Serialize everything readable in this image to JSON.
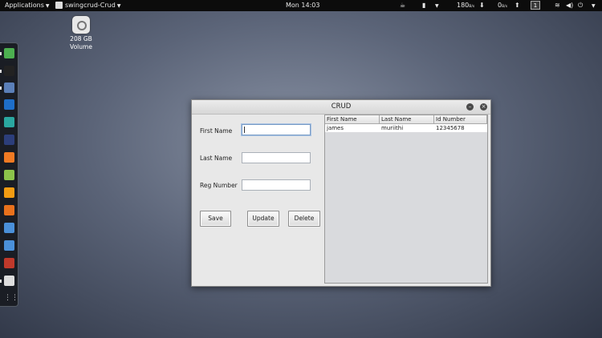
{
  "topbar": {
    "applications": "Applications",
    "app_name": "swingcrud-Crud",
    "clock": "Mon 14:03",
    "net_down": "180",
    "net_down_unit": "B/s",
    "net_up": "0",
    "net_up_unit": "B/s",
    "workspace": "1"
  },
  "desktop": {
    "volume_label_1": "208 GB",
    "volume_label_2": "Volume"
  },
  "window": {
    "title": "CRUD",
    "form": {
      "first_name_label": "First Name",
      "last_name_label": "Last Name",
      "reg_number_label": "Reg Number",
      "first_name_value": "",
      "last_name_value": "",
      "reg_number_value": ""
    },
    "buttons": {
      "save": "Save",
      "update": "Update",
      "delete": "Delete"
    },
    "table": {
      "headers": [
        "First Name",
        "Last Name",
        "Id Number"
      ],
      "rows": [
        [
          "james",
          "muriithi",
          "12345678"
        ]
      ]
    }
  },
  "dock": {
    "icons": [
      "chrome-icon",
      "terminal-icon",
      "files-icon",
      "mail-icon",
      "game-icon",
      "code-icon",
      "firefox-icon",
      "notes-icon",
      "sublime-icon",
      "presentation-icon",
      "box-icon",
      "box-icon",
      "video-icon",
      "java-icon",
      "app-grid-icon"
    ],
    "colors": [
      "#4caf50",
      "#222222",
      "#5b7fb8",
      "#1e6ec8",
      "#2aa7a0",
      "#2c3e7a",
      "#f07a23",
      "#8bc34a",
      "#f39c12",
      "#e8711c",
      "#4a90d9",
      "#4a90d9",
      "#c0392b",
      "#dddddd",
      "#888888"
    ]
  }
}
